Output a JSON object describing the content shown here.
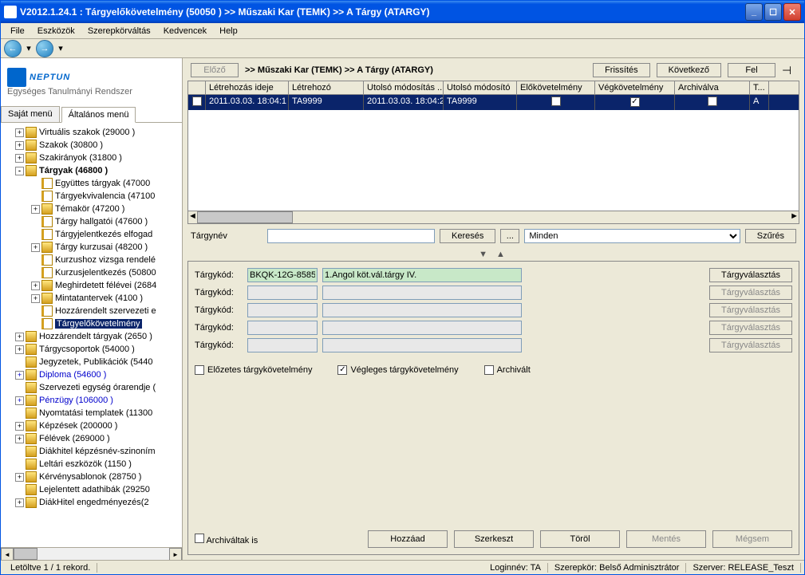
{
  "window": {
    "title": "V2012.1.24.1 : Tárgyelőkövetelmény (50050  )  >> Műszaki Kar (TEMK) >> A Tárgy (ATARGY)"
  },
  "menu": {
    "items": [
      "File",
      "Eszközök",
      "Szerepkörváltás",
      "Kedvencek",
      "Help"
    ]
  },
  "logo": {
    "text": "NEPTUN",
    "subtitle": "Egységes Tanulmányi Rendszer"
  },
  "sidetabs": {
    "t0": "Saját menü",
    "t1": "Általános menü"
  },
  "tree": [
    {
      "l": 1,
      "exp": "+",
      "icon": "folder",
      "label": "Virtuális szakok (29000  )"
    },
    {
      "l": 1,
      "exp": "+",
      "icon": "folder",
      "label": "Szakok (30800  )"
    },
    {
      "l": 1,
      "exp": "+",
      "icon": "folder",
      "label": "Szakirányok (31800  )"
    },
    {
      "l": 1,
      "exp": "-",
      "icon": "folder",
      "label": "Tárgyak (46800  )",
      "bold": true
    },
    {
      "l": 2,
      "exp": " ",
      "icon": "page",
      "label": "Együttes tárgyak (47000"
    },
    {
      "l": 2,
      "exp": " ",
      "icon": "page",
      "label": "Tárgyekvivalencia (47100"
    },
    {
      "l": 2,
      "exp": "+",
      "icon": "folder",
      "label": "Témakör (47200  )"
    },
    {
      "l": 2,
      "exp": " ",
      "icon": "page",
      "label": "Tárgy hallgatói (47600  )"
    },
    {
      "l": 2,
      "exp": " ",
      "icon": "page",
      "label": "Tárgyjelentkezés elfogad"
    },
    {
      "l": 2,
      "exp": "+",
      "icon": "folder",
      "label": "Tárgy kurzusai (48200  )"
    },
    {
      "l": 2,
      "exp": " ",
      "icon": "page",
      "label": "Kurzushoz vizsga rendelé"
    },
    {
      "l": 2,
      "exp": " ",
      "icon": "page",
      "label": "Kurzusjelentkezés (50800"
    },
    {
      "l": 2,
      "exp": "+",
      "icon": "folder",
      "label": "Meghirdetett félévei (2684"
    },
    {
      "l": 2,
      "exp": "+",
      "icon": "folder",
      "label": "Mintatantervek (4100  )"
    },
    {
      "l": 2,
      "exp": " ",
      "icon": "page",
      "label": "Hozzárendelt szervezeti e"
    },
    {
      "l": 2,
      "exp": " ",
      "icon": "page",
      "label": "Tárgyelőkövetelmény",
      "selected": true
    },
    {
      "l": 1,
      "exp": "+",
      "icon": "folder",
      "label": "Hozzárendelt tárgyak (2650  )"
    },
    {
      "l": 1,
      "exp": "+",
      "icon": "folder",
      "label": "Tárgycsoportok (54000  )"
    },
    {
      "l": 1,
      "exp": " ",
      "icon": "folder",
      "label": "Jegyzetek, Publikációk (5440"
    },
    {
      "l": 1,
      "exp": "+",
      "icon": "folder",
      "label": "Diploma (54600  )",
      "blue": true
    },
    {
      "l": 1,
      "exp": " ",
      "icon": "folder",
      "label": "Szervezeti egység órarendje ("
    },
    {
      "l": 1,
      "exp": "+",
      "icon": "folder",
      "label": "Pénzügy (106000  )",
      "blue": true
    },
    {
      "l": 1,
      "exp": " ",
      "icon": "folder",
      "label": "Nyomtatási templatek (11300"
    },
    {
      "l": 1,
      "exp": "+",
      "icon": "folder",
      "label": "Képzések (200000  )"
    },
    {
      "l": 1,
      "exp": "+",
      "icon": "folder",
      "label": "Félévek (269000  )"
    },
    {
      "l": 1,
      "exp": " ",
      "icon": "folder",
      "label": "Diákhitel képzésnév-szinoním"
    },
    {
      "l": 1,
      "exp": " ",
      "icon": "folder",
      "label": "Leltári eszközök (1150  )"
    },
    {
      "l": 1,
      "exp": "+",
      "icon": "folder",
      "label": "Kérvénysablonok (28750  )"
    },
    {
      "l": 1,
      "exp": " ",
      "icon": "folder",
      "label": "Lejelentett adathibák (29250"
    },
    {
      "l": 1,
      "exp": "+",
      "icon": "folder",
      "label": "DiákHitel engedményezés(2"
    }
  ],
  "topbar": {
    "prev": "Előző",
    "breadcrumb": ">> Műszaki Kar (TEMK) >> A Tárgy (ATARGY)",
    "refresh": "Frissítés",
    "next": "Következő",
    "up": "Fel"
  },
  "grid": {
    "headers": [
      "",
      "Létrehozás ideje",
      "Létrehozó",
      "Utolsó módosítás ...",
      "Utolsó módosító",
      "Előkövetelmény",
      "Végkövetelmény",
      "Archiválva",
      "T..."
    ],
    "row": {
      "c1": "2011.03.03. 18:04:1",
      "c2": "TA9999",
      "c3": "2011.03.03. 18:04:2",
      "c4": "TA9999",
      "c5": false,
      "c6": true,
      "c7": false,
      "c8": "A"
    }
  },
  "search": {
    "label": "Tárgynév",
    "btn": "Keresés",
    "dots": "...",
    "select": "Minden",
    "filter": "Szűrés"
  },
  "detail": {
    "label": "Tárgykód:",
    "code0": "BKQK-12G-8585",
    "name0": "1.Angol köt.vál.tárgy IV.",
    "pickbtn": "Tárgyválasztás",
    "chk1": "Előzetes tárgykövetelmény",
    "chk2": "Végleges tárgykövetelmény",
    "chk3": "Archivált",
    "chk_bottom": "Archiváltak is",
    "btn_add": "Hozzáad",
    "btn_edit": "Szerkeszt",
    "btn_del": "Töröl",
    "btn_save": "Mentés",
    "btn_cancel": "Mégsem"
  },
  "status": {
    "left": "Letöltve 1 / 1 rekord.",
    "login": "Loginnév: TA",
    "role": "Szerepkör: Belső Adminisztrátor",
    "server": "Szerver: RELEASE_Teszt"
  }
}
